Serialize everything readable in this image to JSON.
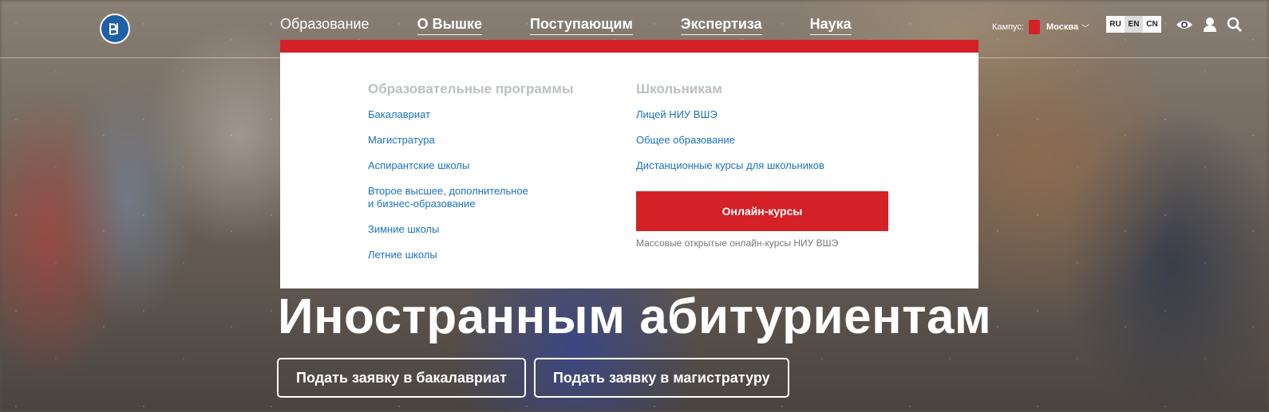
{
  "header": {
    "logo_icon": "hse-logo-icon",
    "nav": [
      {
        "label": "Образование"
      },
      {
        "label": "О Вышке"
      },
      {
        "label": "Поступающим"
      },
      {
        "label": "Экспертиза"
      },
      {
        "label": "Наука"
      }
    ],
    "campus_label": "Кампус:",
    "campus_city": "Москва",
    "languages": [
      "RU",
      "EN",
      "CN"
    ],
    "active_language": "EN",
    "icons": [
      "eye-icon",
      "user-icon",
      "search-icon"
    ]
  },
  "dropdown": {
    "left_title": "Образовательные программы",
    "left_links": [
      "Бакалавриат",
      "Магистратура",
      "Аспирантские школы",
      "Второе высшее, дополнительное",
      "и бизнес-образование",
      "Зимние школы",
      "Летние школы"
    ],
    "right_title": "Школьникам",
    "right_links": [
      "Лицей НИУ ВШЭ",
      "Общее образование",
      "Дистанционные курсы для школьников"
    ],
    "cta_label": "Онлайн-курсы",
    "cta_note": "Массовые открытые онлайн-курсы НИУ ВШЭ"
  },
  "hero": {
    "title": "Иностранным абитуриентам",
    "buttons": [
      "Подать заявку в бакалавриат",
      "Подать заявку в магистратуру"
    ]
  },
  "colors": {
    "accent": "#d42027",
    "link": "#1a73c0",
    "logo": "#1f5fa6"
  }
}
